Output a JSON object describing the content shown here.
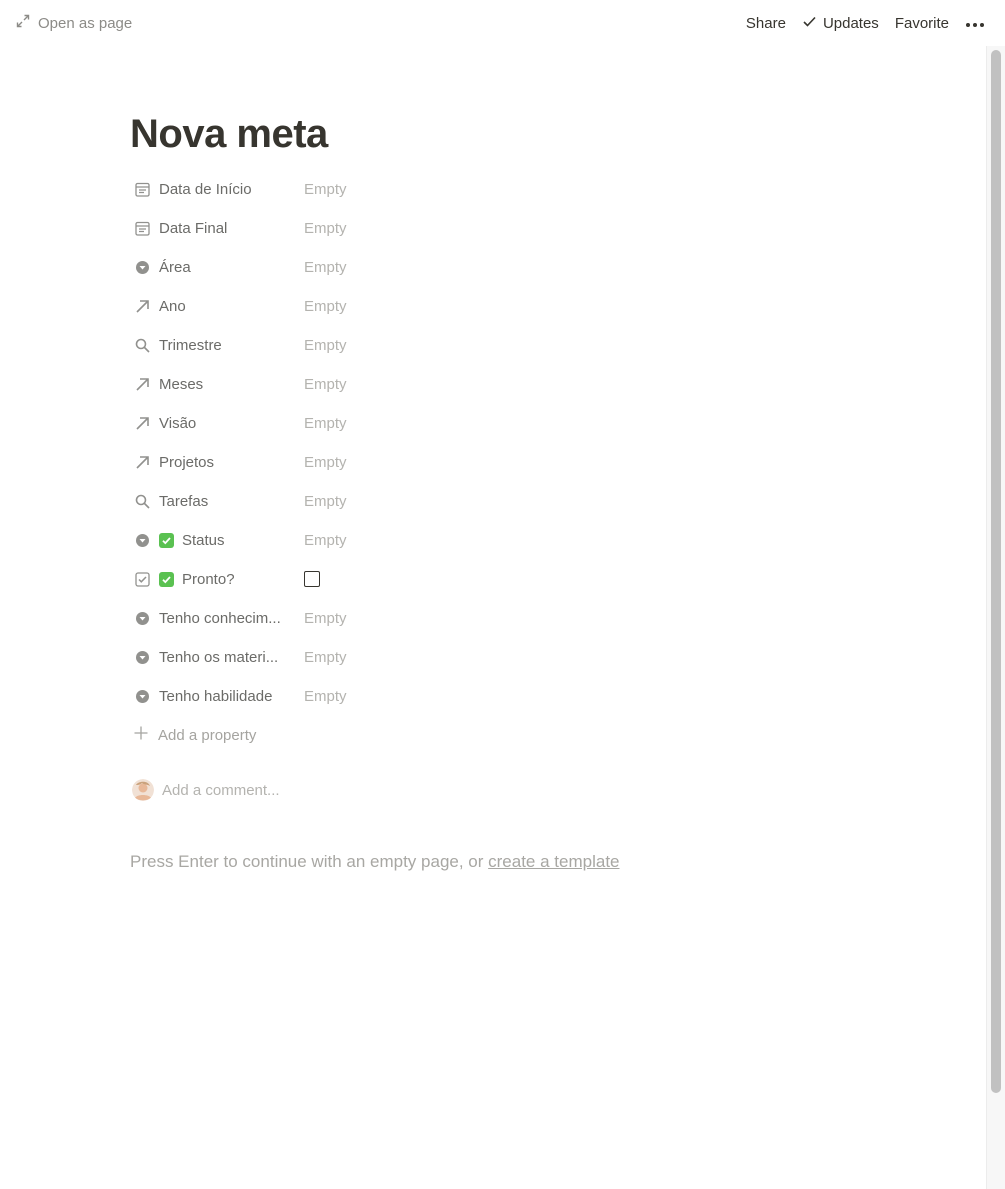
{
  "topbar": {
    "open_as_page": "Open as page",
    "share": "Share",
    "updates": "Updates",
    "favorite": "Favorite"
  },
  "page": {
    "title": "Nova meta"
  },
  "properties": [
    {
      "icon": "calendar-icon",
      "label": "Data de Início",
      "value": "Empty"
    },
    {
      "icon": "calendar-icon",
      "label": "Data Final",
      "value": "Empty"
    },
    {
      "icon": "select-icon",
      "label": "Área",
      "value": "Empty"
    },
    {
      "icon": "relation-arrow-icon",
      "label": "Ano",
      "value": "Empty"
    },
    {
      "icon": "rollup-search-icon",
      "label": "Trimestre",
      "value": "Empty"
    },
    {
      "icon": "relation-arrow-icon",
      "label": "Meses",
      "value": "Empty"
    },
    {
      "icon": "relation-arrow-icon",
      "label": "Visão",
      "value": "Empty"
    },
    {
      "icon": "relation-arrow-icon",
      "label": "Projetos",
      "value": "Empty"
    },
    {
      "icon": "rollup-search-icon",
      "label": "Tarefas",
      "value": "Empty"
    },
    {
      "icon": "select-icon",
      "label": "Status",
      "value": "Empty",
      "emoji": "check-mark-button-icon"
    },
    {
      "icon": "checkbox-property-icon",
      "label": "Pronto?",
      "value": "",
      "emoji": "check-mark-button-icon",
      "checked": false
    },
    {
      "icon": "select-icon",
      "label": "Tenho conhecim...",
      "value": "Empty"
    },
    {
      "icon": "select-icon",
      "label": "Tenho os materi...",
      "value": "Empty"
    },
    {
      "icon": "select-icon",
      "label": "Tenho habilidade",
      "value": "Empty"
    }
  ],
  "add_property": "Add a property",
  "comment": {
    "placeholder": "Add a comment..."
  },
  "empty_hint": {
    "text": "Press Enter to continue with an empty page, or ",
    "link": "create a template"
  },
  "colors": {
    "text": "#37352f",
    "muted": "#8c8b87",
    "placeholder": "#b4b3af",
    "emoji_check": "#5ac151"
  }
}
